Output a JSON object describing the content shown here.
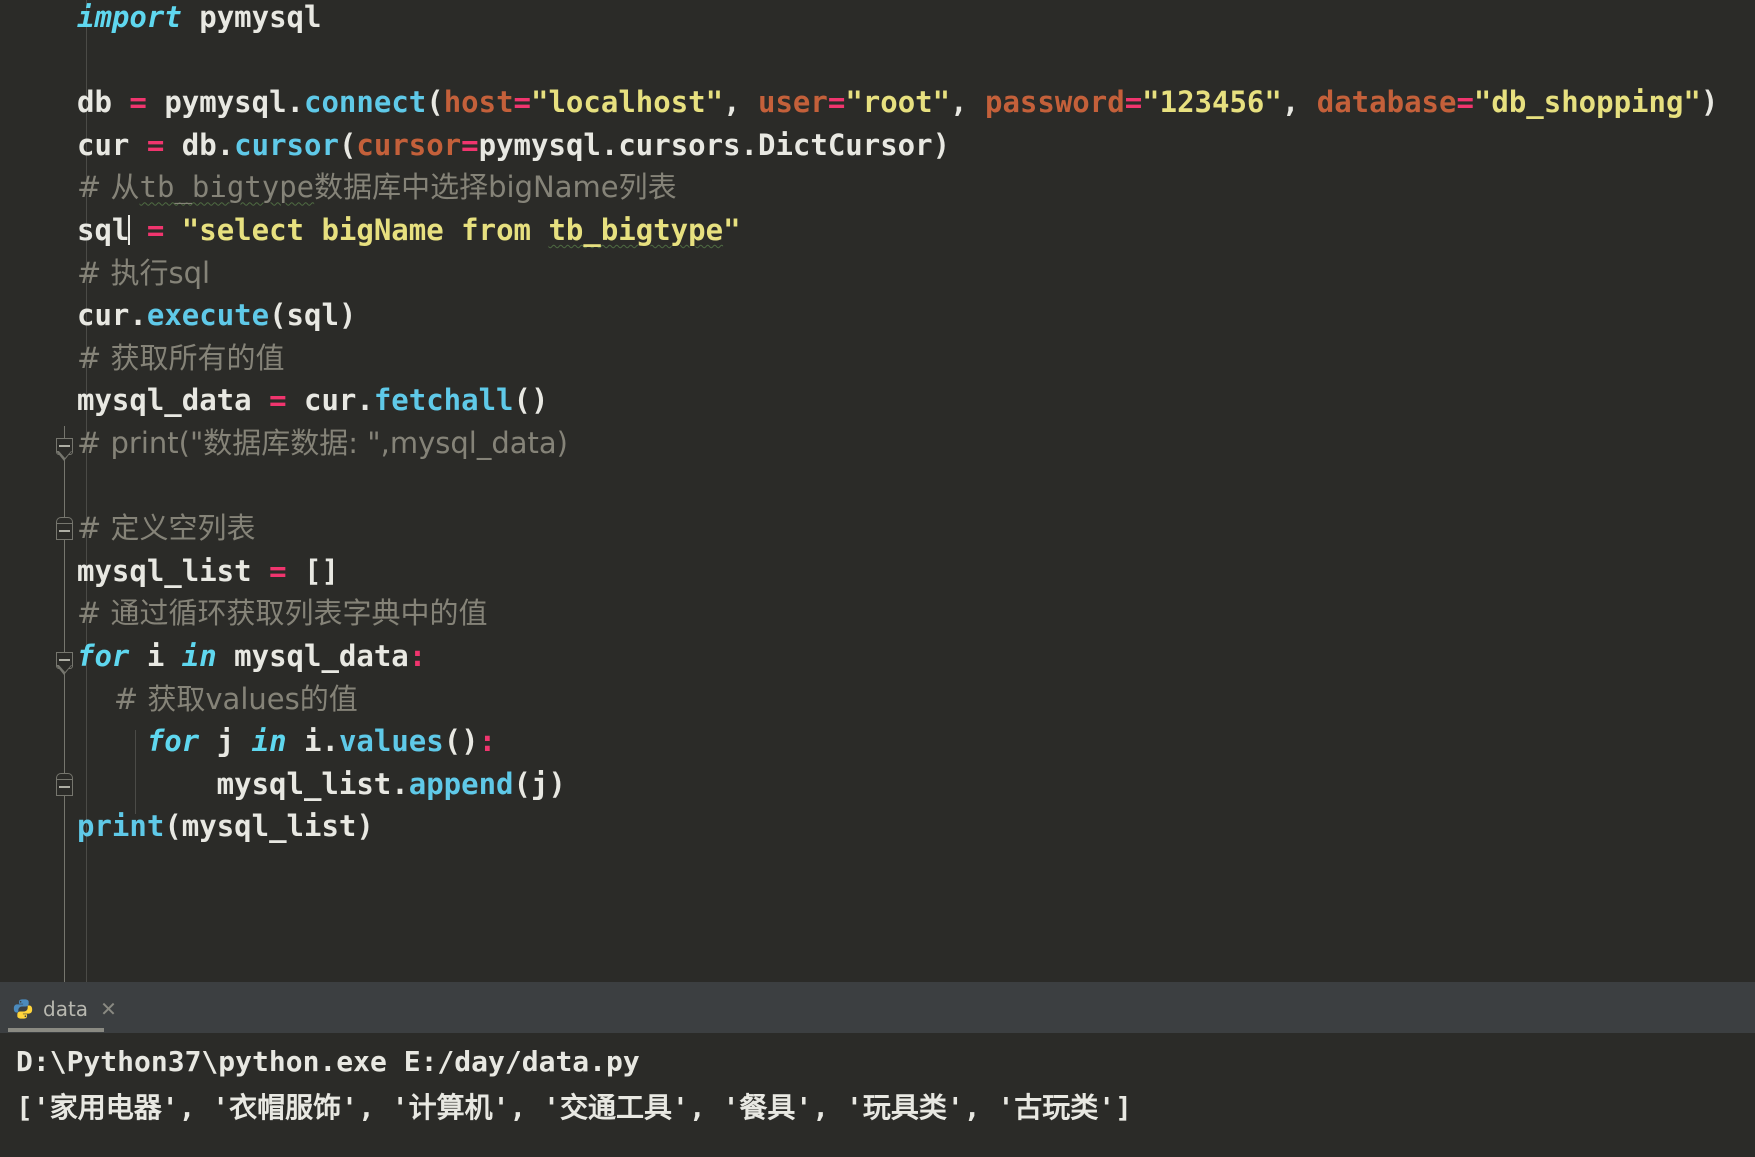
{
  "editor": {
    "language": "python",
    "background_color": "#2b2b28",
    "lines": [
      {
        "id": "l1",
        "indent": 0,
        "text": "import pymysql"
      },
      {
        "id": "l2",
        "indent": 0,
        "text": ""
      },
      {
        "id": "l3",
        "indent": 0,
        "text": "db = pymysql.connect(host=\"localhost\", user=\"root\", password=\"123456\", database=\"db_shopping\")"
      },
      {
        "id": "l4",
        "indent": 0,
        "text": "cur = db.cursor(cursor=pymysql.cursors.DictCursor)"
      },
      {
        "id": "l5",
        "indent": 0,
        "text": "# 从tb_bigtype数据库中选择bigName列表"
      },
      {
        "id": "l6",
        "indent": 0,
        "text": "sql = \"select bigName from tb_bigtype\""
      },
      {
        "id": "l7",
        "indent": 0,
        "text": "# 执行sql"
      },
      {
        "id": "l8",
        "indent": 0,
        "text": "cur.execute(sql)"
      },
      {
        "id": "l9",
        "indent": 0,
        "text": "# 获取所有的值"
      },
      {
        "id": "l10",
        "indent": 0,
        "text": "mysql_data = cur.fetchall()"
      },
      {
        "id": "l11",
        "indent": 0,
        "text": "# print(\"数据库数据: \",mysql_data)"
      },
      {
        "id": "l12",
        "indent": 0,
        "text": ""
      },
      {
        "id": "l13",
        "indent": 0,
        "text": "# 定义空列表"
      },
      {
        "id": "l14",
        "indent": 0,
        "text": "mysql_list = []"
      },
      {
        "id": "l15",
        "indent": 0,
        "text": "# 通过循环获取列表字典中的值"
      },
      {
        "id": "l16",
        "indent": 0,
        "text": "for i in mysql_data:"
      },
      {
        "id": "l17",
        "indent": 1,
        "text": "# 获取values的值"
      },
      {
        "id": "l18",
        "indent": 1,
        "text": "for j in i.values():"
      },
      {
        "id": "l19",
        "indent": 2,
        "text": "mysql_list.append(j)"
      },
      {
        "id": "l20",
        "indent": 0,
        "text": "print(mysql_list)"
      }
    ],
    "tokens": {
      "import_keyword": "import",
      "module_name": "pymysql",
      "for_keyword": "for",
      "in_keyword": "in"
    },
    "spellcheck_words": [
      "tb_bigtype",
      "tb_bigtype"
    ],
    "fold_markers": [
      {
        "id": "fold-print-comment",
        "line": "l11",
        "state": "collapsible"
      },
      {
        "id": "fold-block-comment",
        "line": "l13",
        "state": "collapsible"
      },
      {
        "id": "fold-for-loop",
        "line": "l16",
        "state": "collapsible"
      },
      {
        "id": "fold-for-loop-end",
        "line": "l19",
        "state": "collapsible-end"
      }
    ],
    "colors": {
      "keyword": "#cc7832",
      "keyword_italic": "#5fd7ef",
      "function": "#5fc9e8",
      "string": "#e7e07f",
      "operator": "#f0356e",
      "named_argument": "#c4603a",
      "comment": "#858378",
      "default_text": "#e8e8e2",
      "spellcheck_underline": "#4e6b42"
    }
  },
  "console": {
    "tab": {
      "label": "data",
      "icon": "python-file-icon",
      "close_icon": "close-icon",
      "active": true
    },
    "output": [
      "D:\\Python37\\python.exe E:/day/data.py",
      "['家用电器', '衣帽服饰', '计算机', '交通工具', '餐具', '玩具类', '古玩类']"
    ],
    "background_color": "#2b2b28",
    "tabbar_color": "#3c3f41"
  }
}
